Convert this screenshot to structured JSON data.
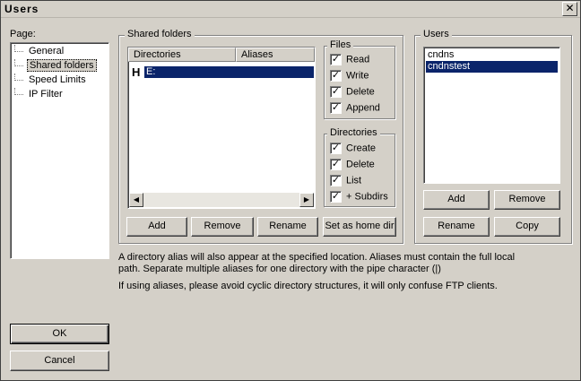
{
  "window": {
    "title": "Users",
    "close_label": "✕"
  },
  "page": {
    "label": "Page:",
    "items": [
      {
        "label": "General",
        "selected": false
      },
      {
        "label": "Shared folders",
        "selected": true
      },
      {
        "label": "Speed Limits",
        "selected": false
      },
      {
        "label": "IP Filter",
        "selected": false
      }
    ]
  },
  "shared_folders": {
    "legend": "Shared folders",
    "columns": [
      "Directories",
      "Aliases"
    ],
    "rows": [
      {
        "home_marker": "H",
        "directory": "E:",
        "alias": ""
      }
    ],
    "buttons": {
      "add": "Add",
      "remove": "Remove",
      "rename": "Rename",
      "set_home": "Set as home dir"
    }
  },
  "files": {
    "legend": "Files",
    "options": [
      {
        "label": "Read",
        "checked": true
      },
      {
        "label": "Write",
        "checked": true
      },
      {
        "label": "Delete",
        "checked": true
      },
      {
        "label": "Append",
        "checked": true
      }
    ]
  },
  "directories": {
    "legend": "Directories",
    "options": [
      {
        "label": "Create",
        "checked": true
      },
      {
        "label": "Delete",
        "checked": true
      },
      {
        "label": "List",
        "checked": true
      },
      {
        "label": "+ Subdirs",
        "checked": true
      }
    ]
  },
  "users": {
    "legend": "Users",
    "items": [
      {
        "label": "cndns",
        "selected": false
      },
      {
        "label": "cndnstest",
        "selected": true
      }
    ],
    "buttons": {
      "add": "Add",
      "remove": "Remove",
      "rename": "Rename",
      "copy": "Copy"
    }
  },
  "info": {
    "line1": "A directory alias will also appear at the specified location. Aliases must contain the full local",
    "line2": "path. Separate multiple aliases for one directory with the pipe character (|)",
    "line3": "If using aliases, please avoid cyclic directory structures, it will only confuse FTP clients."
  },
  "dialog_buttons": {
    "ok": "OK",
    "cancel": "Cancel"
  }
}
